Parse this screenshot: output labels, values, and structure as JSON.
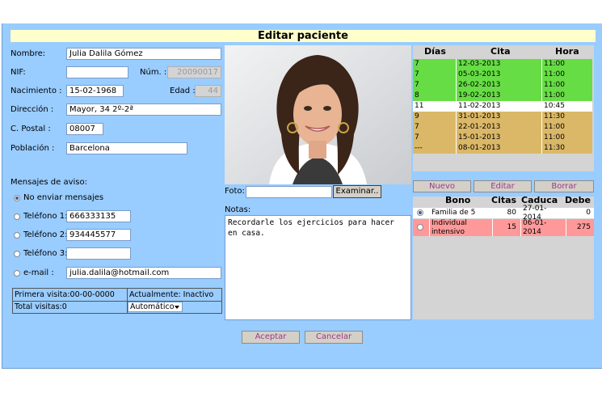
{
  "window": {
    "title": "Editar paciente"
  },
  "form": {
    "nombre": {
      "label": "Nombre:",
      "value": "Julia Dalila Gómez"
    },
    "nif": {
      "label": "NIF:",
      "value": ""
    },
    "num": {
      "label": "Núm. :",
      "value": "20090017"
    },
    "nacimiento": {
      "label": "Nacimiento :",
      "value": "15-02-1968"
    },
    "edad": {
      "label": "Edad :",
      "value": "44"
    },
    "direccion": {
      "label": "Dirección :",
      "value": "Mayor, 34 2º-2ª"
    },
    "cpostal": {
      "label": "C. Postal :",
      "value": "08007"
    },
    "poblacion": {
      "label": "Población :",
      "value": "Barcelona"
    }
  },
  "avisos": {
    "heading": "Mensajes de aviso:",
    "options": [
      {
        "label": "No enviar mensajes",
        "value": "",
        "selected": true
      },
      {
        "label": "Teléfono 1:",
        "value": "666333135",
        "selected": false
      },
      {
        "label": "Teléfono 2:",
        "value": "934445577",
        "selected": false
      },
      {
        "label": "Teléfono 3:",
        "value": "",
        "selected": false
      },
      {
        "label": "e-mail :",
        "value": "julia.dalila@hotmail.com",
        "selected": false
      }
    ]
  },
  "stats": {
    "primera_visita": "Primera visita:00-00-0000",
    "actualmente": "Actualmente: Inactivo",
    "total_visitas": "Total visitas:0",
    "modo": "Automático"
  },
  "photo": {
    "foto_label": "Foto:",
    "foto_value": "",
    "browse_label": "Examinar.."
  },
  "notes": {
    "label": "Notas:",
    "text": "Recordarle los ejercicios para hacer\nen casa."
  },
  "appointments": {
    "headers": {
      "dias": "Días",
      "cita": "Cita",
      "hora": "Hora"
    },
    "rows": [
      {
        "dias": "7",
        "cita": "12-03-2013",
        "hora": "11:00",
        "color": "#66dd44"
      },
      {
        "dias": "7",
        "cita": "05-03-2013",
        "hora": "11:00",
        "color": "#66dd44"
      },
      {
        "dias": "7",
        "cita": "26-02-2013",
        "hora": "11:00",
        "color": "#66dd44"
      },
      {
        "dias": "8",
        "cita": "19-02-2013",
        "hora": "11:00",
        "color": "#66dd44"
      },
      {
        "dias": "11",
        "cita": "11-02-2013",
        "hora": "10:45",
        "color": "#ffffff"
      },
      {
        "dias": "9",
        "cita": "31-01-2013",
        "hora": "11:30",
        "color": "#dbb868"
      },
      {
        "dias": "7",
        "cita": "22-01-2013",
        "hora": "11:00",
        "color": "#dbb868"
      },
      {
        "dias": "7",
        "cita": "15-01-2013",
        "hora": "11:00",
        "color": "#dbb868"
      },
      {
        "dias": "---",
        "cita": "08-01-2013",
        "hora": "11:30",
        "color": "#dbb868"
      }
    ]
  },
  "bono_toolbar": {
    "nuevo": "Nuevo",
    "editar": "Editar",
    "borrar": "Borrar"
  },
  "bonos": {
    "headers": {
      "bono": "Bono",
      "citas": "Citas",
      "caduca": "Caduca",
      "debe": "Debe"
    },
    "rows": [
      {
        "bono": "Familia de 5",
        "citas": "80",
        "caduca": "27-01-2014",
        "debe": "0",
        "selected": true,
        "color": "#ffffff"
      },
      {
        "bono": "Individual intensivo",
        "citas": "15",
        "caduca": "06-01-2014",
        "debe": "275",
        "selected": false,
        "color": "#ff9999"
      }
    ]
  },
  "actions": {
    "aceptar": "Aceptar",
    "cancelar": "Cancelar"
  }
}
